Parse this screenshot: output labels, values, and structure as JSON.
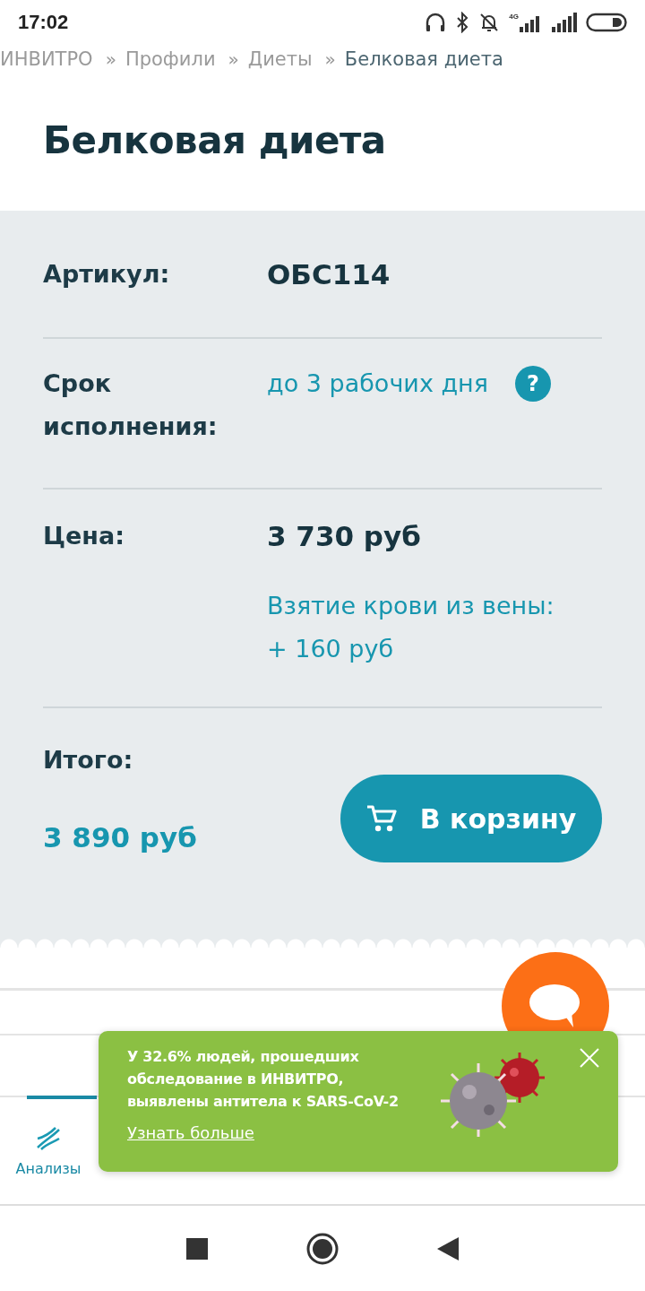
{
  "status_bar": {
    "time": "17:02",
    "network": "4G"
  },
  "breadcrumbs": [
    {
      "label": "ИНВИТРО",
      "current": false
    },
    {
      "separator": "»",
      "label": "Профили",
      "current": false
    },
    {
      "separator": "»",
      "label": "Диеты",
      "current": false
    },
    {
      "separator": "»",
      "label": "Белковая диета",
      "current": true
    }
  ],
  "title": "Белковая диета",
  "details": [
    {
      "kind": "text",
      "label": "Артикул:",
      "value": "ОБС114"
    },
    {
      "kind": "duration",
      "label": "Срок исполнения:",
      "value": "до 3 рабочих дня",
      "help": "?"
    },
    {
      "kind": "price",
      "label": "Цена:",
      "value": "3 730 руб",
      "note": "Взятие крови из вены: + 160 руб"
    }
  ],
  "total": {
    "label": "Итого:",
    "value": "3 890 руб",
    "button": "В корзину"
  },
  "bottom_nav": [
    {
      "label": "Анализы",
      "selected": true
    }
  ],
  "promo": {
    "text": "У 32.6% людей, прошедших обследование в ИНВИТРО, выявлены антитела к SARS-CoV-2",
    "link": "Узнать больше"
  }
}
